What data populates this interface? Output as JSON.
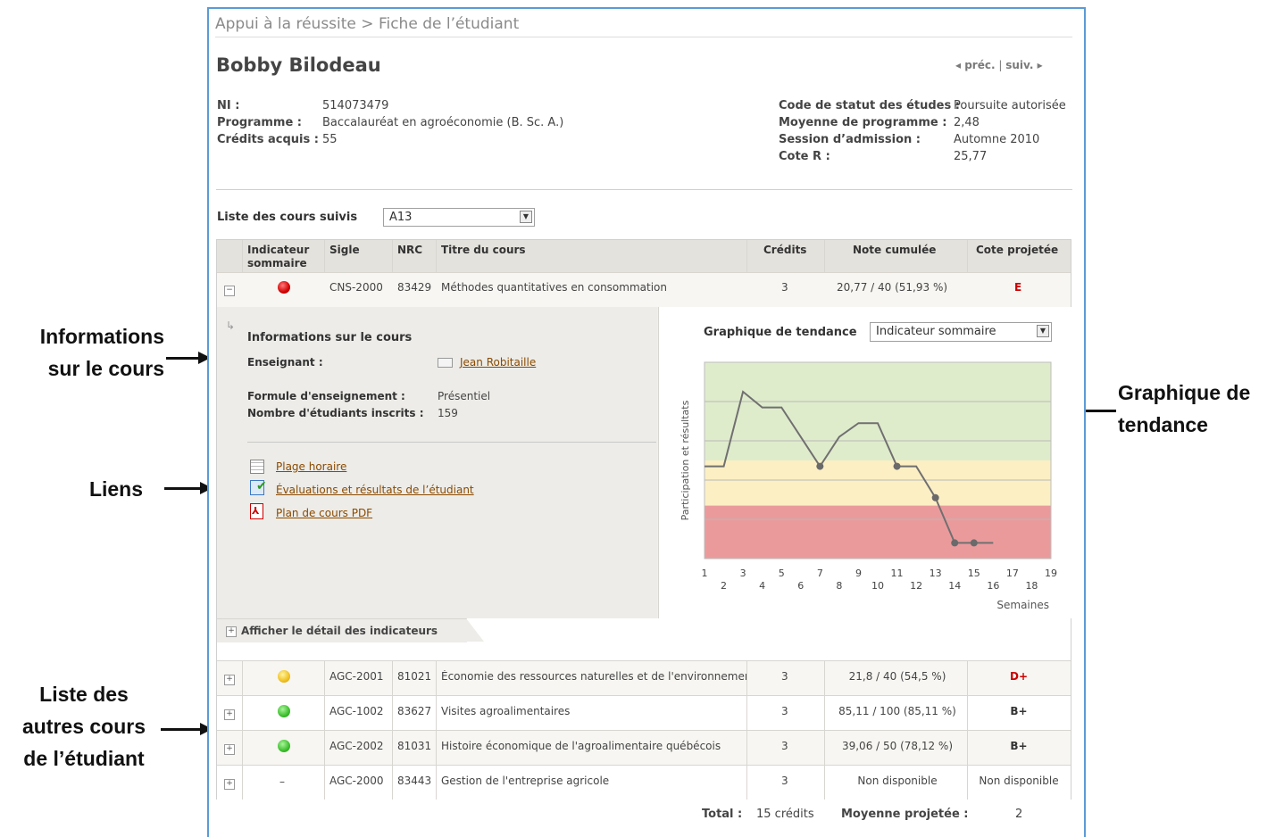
{
  "breadcrumb": "Appui à la réussite > Fiche de l’étudiant",
  "student": {
    "name": "Bobby Bilodeau",
    "nav_prev": "◂ préc.",
    "nav_sep": "|",
    "nav_next": "suiv. ▸",
    "left_info": [
      {
        "label": "NI :",
        "value": "514073479"
      },
      {
        "label": "Programme :",
        "value": "Baccalauréat en agroéconomie (B. Sc. A.)"
      },
      {
        "label": "Crédits acquis :",
        "value": "55"
      }
    ],
    "right_info": [
      {
        "label": "Code de statut des études :",
        "value": "Poursuite autorisée"
      },
      {
        "label": "Moyenne de programme :",
        "value": "2,48"
      },
      {
        "label": "Session d’admission :",
        "value": "Automne 2010"
      },
      {
        "label": "Cote R :",
        "value": "25,77"
      }
    ]
  },
  "course_list": {
    "label": "Liste des cours suivis",
    "session_value": "A13"
  },
  "table": {
    "headers": {
      "indicator": "Indicateur sommaire",
      "sigle": "Sigle",
      "nrc": "NRC",
      "title": "Titre du cours",
      "credits": "Crédits",
      "grade": "Note cumulée",
      "projected": "Cote projetée"
    },
    "expanded_row": {
      "expand": "−",
      "indicator": "red",
      "sigle": "CNS-2000",
      "nrc": "83429",
      "title": "Méthodes quantitatives en consommation",
      "credits": "3",
      "grade": "20,77 / 40 (51,93 %)",
      "projected": "E"
    },
    "rows": [
      {
        "expand": "+",
        "indicator": "yellow",
        "sigle": "AGC-2001",
        "nrc": "81021",
        "title": "Économie des ressources naturelles et de l'environnement",
        "credits": "3",
        "grade": "21,8 / 40 (54,5 %)",
        "projected": "D+",
        "projected_color": "#cc0000"
      },
      {
        "expand": "+",
        "indicator": "green",
        "sigle": "AGC-1002",
        "nrc": "83627",
        "title": "Visites agroalimentaires",
        "credits": "3",
        "grade": "85,11 / 100 (85,11 %)",
        "projected": "B+",
        "projected_color": "#333333"
      },
      {
        "expand": "+",
        "indicator": "green",
        "sigle": "AGC-2002",
        "nrc": "81031",
        "title": "Histoire économique de l'agroalimentaire québécois",
        "credits": "3",
        "grade": "39,06 / 50 (78,12 %)",
        "projected": "B+",
        "projected_color": "#333333"
      },
      {
        "expand": "+",
        "indicator": "dash",
        "indicator_text": "–",
        "sigle": "AGC-2000",
        "nrc": "83443",
        "title": "Gestion de l'entreprise agricole",
        "credits": "3",
        "grade": "Non disponible",
        "projected": "Non disponible",
        "projected_color": "#444444"
      }
    ]
  },
  "course_info": {
    "heading": "Informations sur le cours",
    "teacher_label": "Enseignant :",
    "teacher_name": "Jean Robitaille",
    "format_label": "Formule d'enseignement :",
    "format_value": "Présentiel",
    "enrolled_label": "Nombre d'étudiants inscrits :",
    "enrolled_value": "159",
    "links": [
      {
        "label": "Plage horaire",
        "icon": "calendar-icon"
      },
      {
        "label": "Évaluations et résultats de l’étudiant",
        "icon": "checklist-icon"
      },
      {
        "label": "Plan de cours PDF",
        "icon": "pdf-icon"
      }
    ],
    "show_detail": "Afficher le détail des indicateurs"
  },
  "trend": {
    "label": "Graphique de tendance",
    "select_value": "Indicateur sommaire"
  },
  "chart_data": {
    "type": "line",
    "title": "",
    "xlabel": "Semaines",
    "ylabel": "Participation et résultats",
    "xlim": [
      1,
      19
    ],
    "ylim": [
      0,
      100
    ],
    "x_ticks_top": [
      "1",
      "3",
      "5",
      "7",
      "9",
      "11",
      "13",
      "15",
      "17",
      "19"
    ],
    "x_ticks_bottom": [
      "2",
      "4",
      "6",
      "8",
      "10",
      "12",
      "14",
      "16",
      "18"
    ],
    "bands": [
      {
        "from": 50,
        "to": 100,
        "color": "#dfeccc"
      },
      {
        "from": 27,
        "to": 50,
        "color": "#fcefc4"
      },
      {
        "from": 0,
        "to": 27,
        "color": "#eb9a9c"
      }
    ],
    "series": [
      {
        "x": [
          1,
          2,
          3,
          4,
          5,
          6,
          7,
          8,
          9,
          10,
          11,
          12,
          13,
          14,
          15,
          16
        ],
        "y": [
          47,
          47,
          85,
          77,
          77,
          62,
          47,
          62,
          69,
          69,
          47,
          47,
          31,
          8,
          8,
          8
        ],
        "markers": [
          7,
          11,
          13,
          14,
          15
        ],
        "color": "#707070"
      }
    ]
  },
  "totals": {
    "total_label": "Total :",
    "total_value": "15 crédits",
    "avg_label": "Moyenne projetée :",
    "avg_value": "2"
  },
  "annotations": {
    "course_info": "Informations\nsur le cours",
    "links": "Liens",
    "other_courses": "Liste des\nautres cours\nde l’étudiant",
    "trend": "Graphique de\ntendance"
  }
}
